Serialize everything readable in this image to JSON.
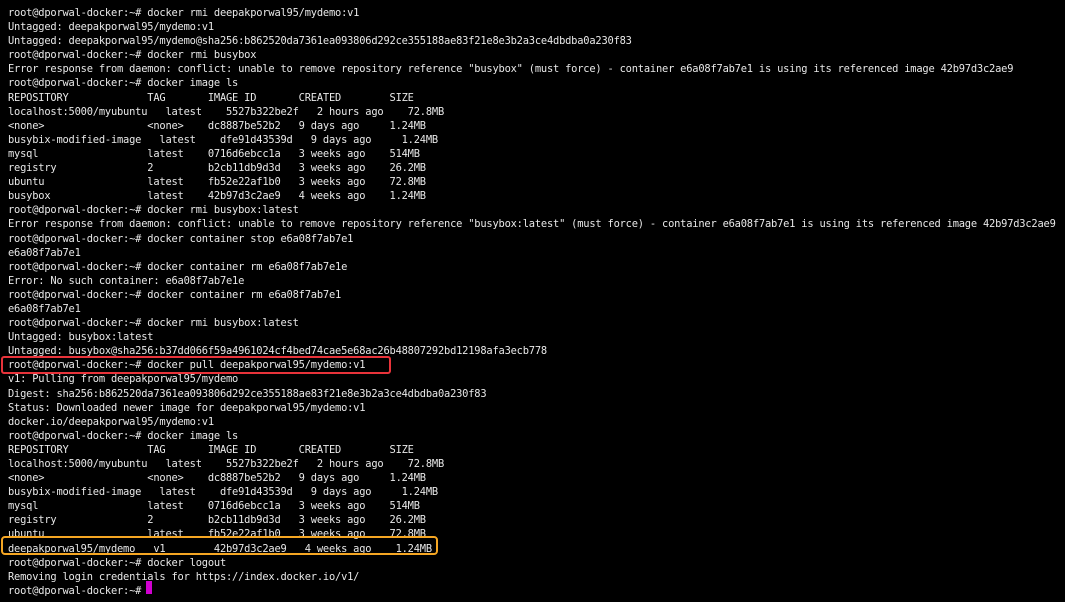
{
  "terminal": {
    "lines": [
      "root@dporwal-docker:~# docker rmi deepakporwal95/mydemo:v1",
      "Untagged: deepakporwal95/mydemo:v1",
      "Untagged: deepakporwal95/mydemo@sha256:b862520da7361ea093806d292ce355188ae83f21e8e3b2a3ce4dbdba0a230f83",
      "root@dporwal-docker:~# docker rmi busybox",
      "Error response from daemon: conflict: unable to remove repository reference \"busybox\" (must force) - container e6a08f7ab7e1 is using its referenced image 42b97d3c2ae9",
      "root@dporwal-docker:~# docker image ls",
      "REPOSITORY             TAG       IMAGE ID       CREATED        SIZE",
      "localhost:5000/myubuntu   latest    5527b322be2f   2 hours ago    72.8MB",
      "<none>                 <none>    dc8887be52b2   9 days ago     1.24MB",
      "busybix-modified-image   latest    dfe91d43539d   9 days ago     1.24MB",
      "mysql                  latest    0716d6ebcc1a   3 weeks ago    514MB",
      "registry               2         b2cb11db9d3d   3 weeks ago    26.2MB",
      "ubuntu                 latest    fb52e22af1b0   3 weeks ago    72.8MB",
      "busybox                latest    42b97d3c2ae9   4 weeks ago    1.24MB",
      "root@dporwal-docker:~# docker rmi busybox:latest",
      "Error response from daemon: conflict: unable to remove repository reference \"busybox:latest\" (must force) - container e6a08f7ab7e1 is using its referenced image 42b97d3c2ae9",
      "root@dporwal-docker:~# docker container stop e6a08f7ab7e1",
      "e6a08f7ab7e1",
      "root@dporwal-docker:~# docker container rm e6a08f7ab7e1e",
      "Error: No such container: e6a08f7ab7e1e",
      "root@dporwal-docker:~# docker container rm e6a08f7ab7e1",
      "e6a08f7ab7e1",
      "root@dporwal-docker:~# docker rmi busybox:latest",
      "Untagged: busybox:latest",
      "Untagged: busybox@sha256:b37dd066f59a4961024cf4bed74cae5e68ac26b48807292bd12198afa3ecb778",
      "root@dporwal-docker:~# docker pull deepakporwal95/mydemo:v1",
      "v1: Pulling from deepakporwal95/mydemo",
      "Digest: sha256:b862520da7361ea093806d292ce355188ae83f21e8e3b2a3ce4dbdba0a230f83",
      "Status: Downloaded newer image for deepakporwal95/mydemo:v1",
      "docker.io/deepakporwal95/mydemo:v1",
      "root@dporwal-docker:~# docker image ls",
      "REPOSITORY             TAG       IMAGE ID       CREATED        SIZE",
      "localhost:5000/myubuntu   latest    5527b322be2f   2 hours ago    72.8MB",
      "<none>                 <none>    dc8887be52b2   9 days ago     1.24MB",
      "busybix-modified-image   latest    dfe91d43539d   9 days ago     1.24MB",
      "mysql                  latest    0716d6ebcc1a   3 weeks ago    514MB",
      "registry               2         b2cb11db9d3d   3 weeks ago    26.2MB",
      "ubuntu                 latest    fb52e22af1b0   3 weeks ago    72.8MB",
      "deepakporwal95/mydemo   v1        42b97d3c2ae9   4 weeks ago    1.24MB",
      "root@dporwal-docker:~# docker logout",
      "Removing login credentials for https://index.docker.io/v1/",
      "root@dporwal-docker:~# "
    ],
    "colors": {
      "background": "#000000",
      "text": "#e8e8e8",
      "cursor": "#d000d0",
      "highlight_pull": "#e8333a",
      "highlight_image_row": "#f5a623"
    }
  }
}
